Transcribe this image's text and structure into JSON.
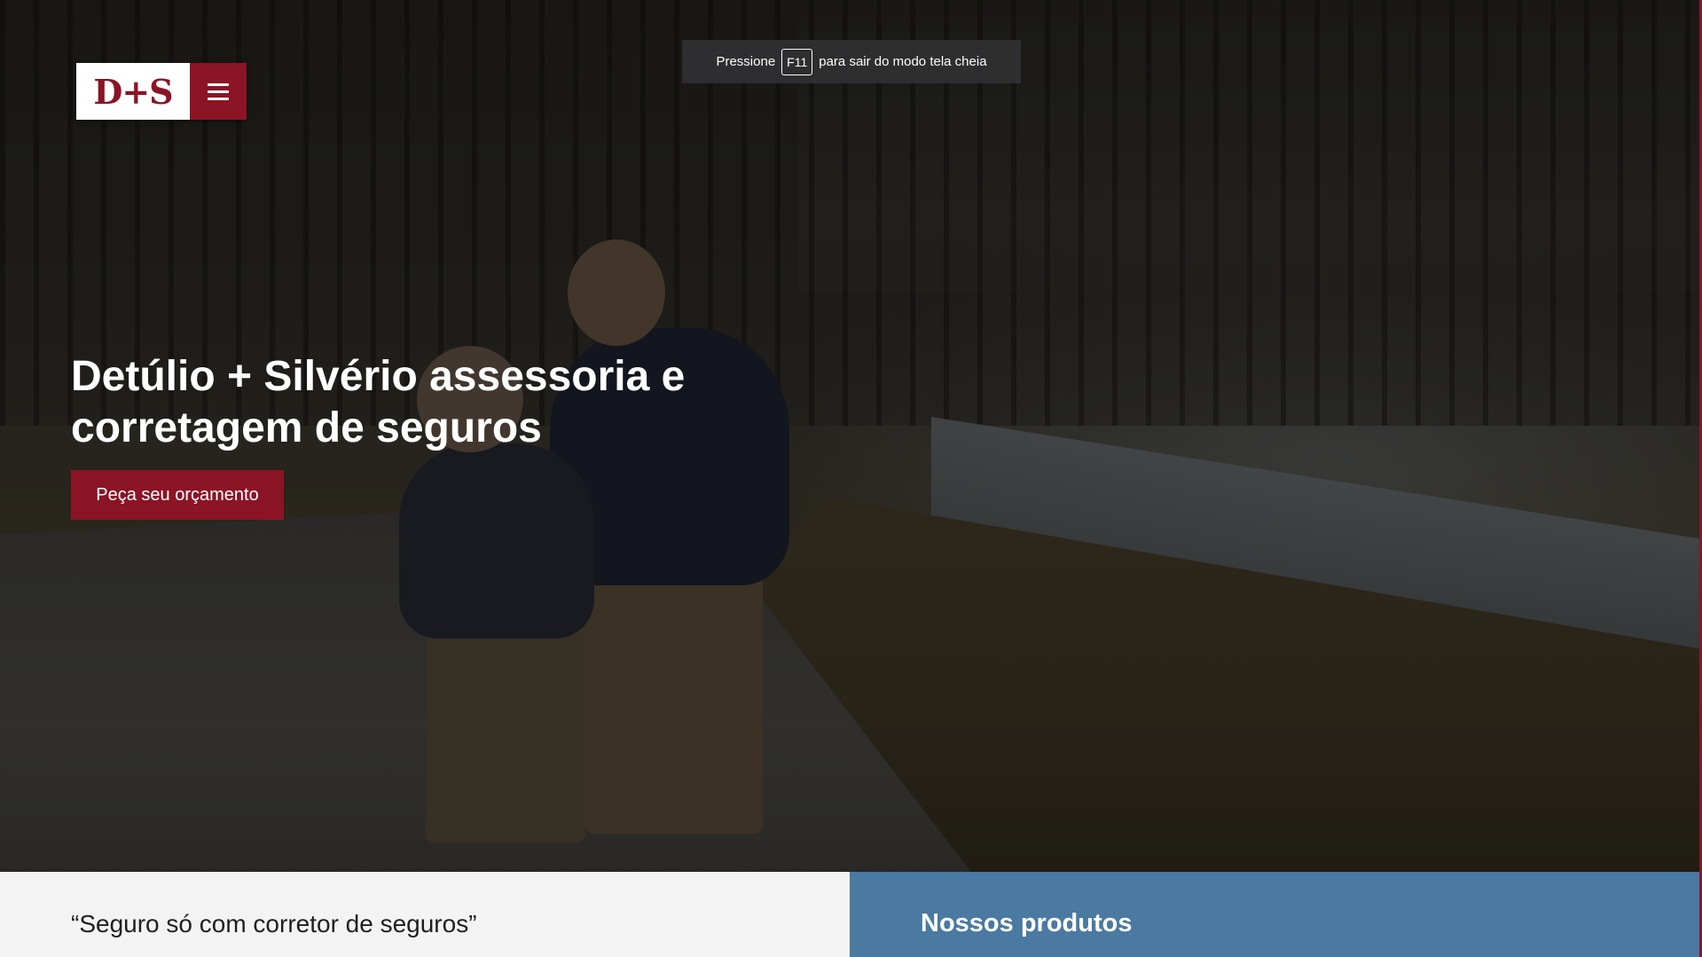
{
  "fullscreen_notice": {
    "prefix": "Pressione",
    "key": "F11",
    "suffix": "para sair do modo tela cheia"
  },
  "header": {
    "logo_text": "D+S",
    "menu_icon": "hamburger-menu-icon"
  },
  "hero": {
    "title_line1": "Detúlio + Silvério assessoria e",
    "title_line2": "corretagem de seguros",
    "cta_label": "Peça seu orçamento"
  },
  "sections": {
    "quote": "“Seguro só com corretor de seguros”",
    "products_title": "Nossos produtos"
  },
  "colors": {
    "brand": "#8b1425",
    "products_bg": "#4a79a1",
    "quote_bg": "#f3f3f3"
  }
}
